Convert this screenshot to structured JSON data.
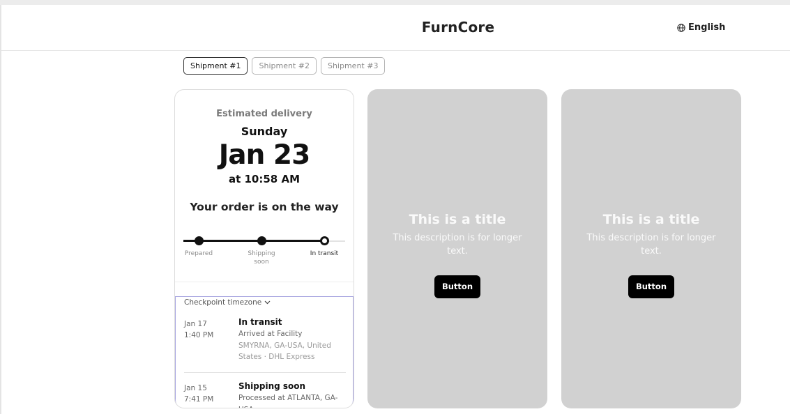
{
  "header": {
    "brand": "FurnCore",
    "language": "English",
    "language_icon": "globe-icon"
  },
  "shipment_tabs": [
    {
      "label": "Shipment #1",
      "active": true
    },
    {
      "label": "Shipment #2",
      "active": false
    },
    {
      "label": "Shipment #3",
      "active": false
    }
  ],
  "delivery": {
    "estimated_label": "Estimated delivery",
    "day": "Sunday",
    "date": "Jan 23",
    "time": "at 10:58 AM",
    "status_message": "Your order is on the way"
  },
  "progress": {
    "steps": [
      {
        "label": "Prepared",
        "done": true
      },
      {
        "label": "Shipping\nsoon",
        "done": true
      },
      {
        "label": "In transit",
        "done": true,
        "current": true
      }
    ]
  },
  "checkpoints": {
    "timezone_label": "Checkpoint timezone",
    "timezone_icon": "chevron-down-icon",
    "items": [
      {
        "date": "Jan 17",
        "time": "1:40 PM",
        "title": "In transit",
        "description": "Arrived at Facility",
        "location": "SMYRNA, GA-USA, United States · DHL Express"
      },
      {
        "date": "Jan 15",
        "time": "7:41 PM",
        "title": "Shipping soon",
        "description": "Processed at ATLANTA, GA-USA",
        "location": ""
      }
    ]
  },
  "promos": [
    {
      "title": "This is a title",
      "description": "This description is for longer text.",
      "button": "Button"
    },
    {
      "title": "This is a title",
      "description": "This description is for longer text.",
      "button": "Button"
    }
  ],
  "colors": {
    "accent": "#111111",
    "promo_bg": "#d1d1d1",
    "checkpoint_border": "#a9a6e0"
  }
}
